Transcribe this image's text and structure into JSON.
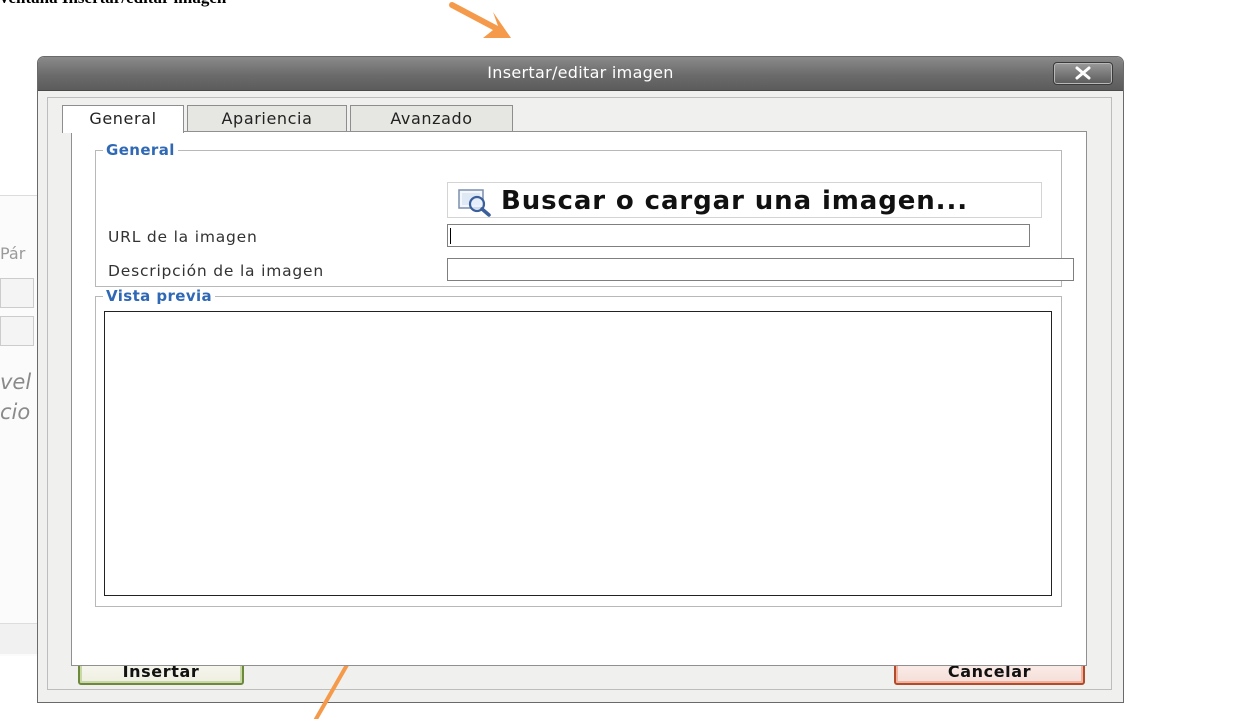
{
  "background_document": {
    "caption_fragment": "ventana Insertar/editar imagen",
    "paragraph_fragment": "Pár",
    "italic_fragment_1": "vel",
    "italic_fragment_2": "cio"
  },
  "dialog": {
    "title": "Insertar/editar imagen",
    "close_icon": "close-x-icon",
    "tabs": [
      {
        "label": "General",
        "active": true
      },
      {
        "label": "Apariencia",
        "active": false
      },
      {
        "label": "Avanzado",
        "active": false
      }
    ],
    "general_section": {
      "legend": "General",
      "browse_button_label": "Buscar o cargar una imagen...",
      "browse_icon": "magnifier-on-image-icon",
      "url_label": "URL de la imagen",
      "url_value": "",
      "description_label": "Descripción de la imagen",
      "description_value": ""
    },
    "preview_section": {
      "legend": "Vista previa"
    },
    "footer": {
      "insert_label": "Insertar",
      "cancel_label": "Cancelar"
    }
  },
  "annotations": {
    "arrow_color": "#f59a4a"
  },
  "colors": {
    "legend_blue": "#2f68b5",
    "titlebar_gray": "#6b6b6b",
    "insert_border": "#6d8a3c",
    "cancel_border": "#b34a2a"
  }
}
